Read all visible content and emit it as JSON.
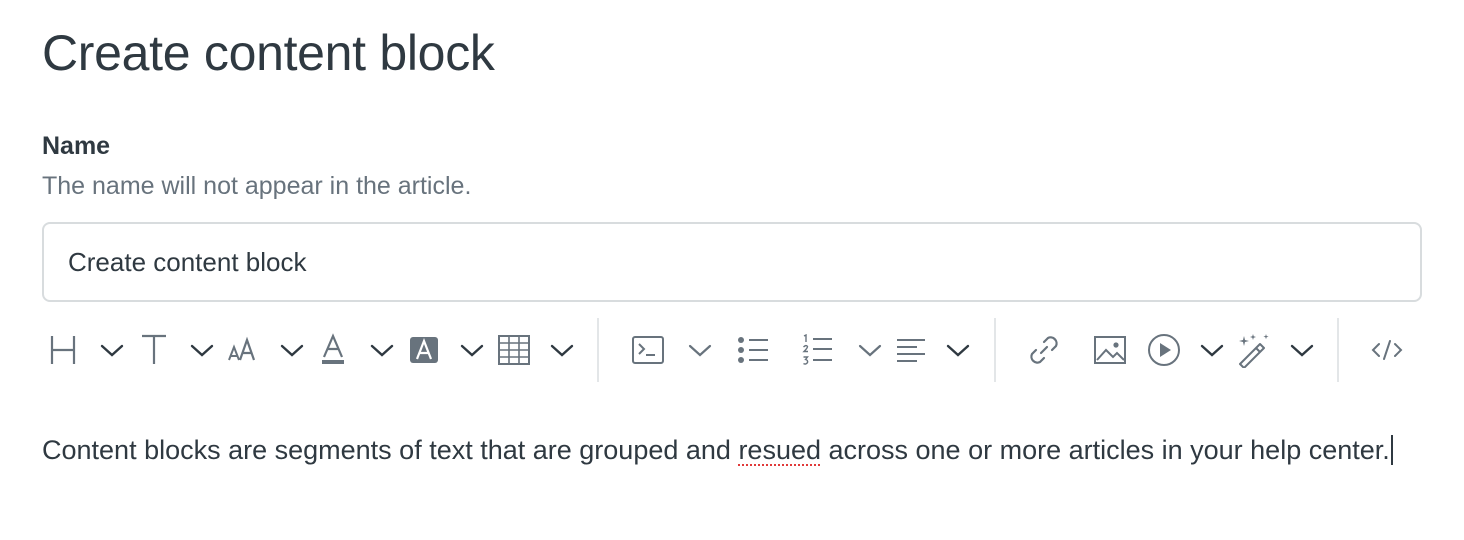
{
  "page": {
    "title": "Create content block"
  },
  "name_field": {
    "label": "Name",
    "hint": "The name will not appear in the article.",
    "value": "Create content block"
  },
  "toolbar": {
    "icons": {
      "heading": "heading-icon",
      "text_style": "text-style-icon",
      "font_size": "font-size-icon",
      "text_color": "text-color-icon",
      "highlight_color": "background-color-icon",
      "table": "table-icon",
      "code_block": "code-block-icon",
      "bulleted_list": "bulleted-list-icon",
      "numbered_list": "numbered-list-icon",
      "align": "align-icon",
      "link": "link-icon",
      "image": "image-icon",
      "video": "video-icon",
      "ai_assist": "magic-wand-icon",
      "source_code": "source-code-icon"
    },
    "text_color_swatch": "#68737d",
    "highlight_swatch": "#68737d",
    "icon_color": "#68737d"
  },
  "editor": {
    "text_before": "Content blocks are segments of text that are grouped and ",
    "misspelled_word": "resued",
    "text_after": " across one or more articles in your help center."
  },
  "colors": {
    "text": "#2f3941",
    "hint": "#68737d",
    "border": "#d8dcde",
    "spellcheck": "#e03a3a"
  }
}
